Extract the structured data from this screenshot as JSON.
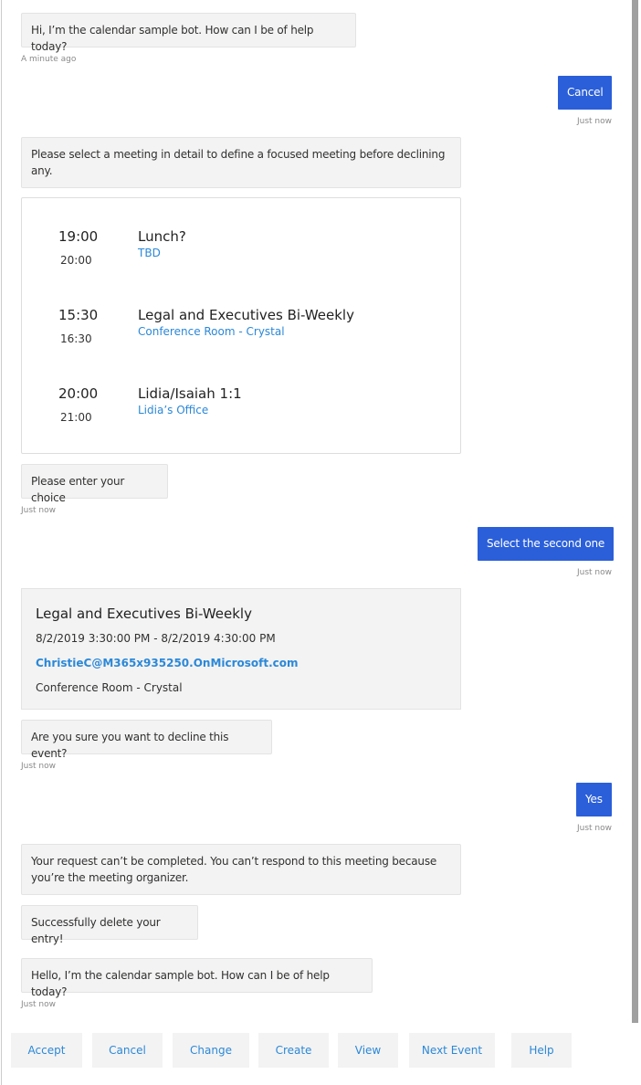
{
  "messages": {
    "m1": {
      "text": "Hi, I’m the calendar sample bot. How can I be of help today?",
      "time": "A minute ago"
    },
    "u1": {
      "text": "Cancel",
      "time": "Just now"
    },
    "m2": {
      "text": "Please select a meeting in detail to define a focused meeting before declining any."
    },
    "meetings": [
      {
        "start": "19:00",
        "end": "20:00",
        "title": "Lunch?",
        "location": "TBD"
      },
      {
        "start": "15:30",
        "end": "16:30",
        "title": "Legal and Executives Bi-Weekly",
        "location": "Conference Room - Crystal"
      },
      {
        "start": "20:00",
        "end": "21:00",
        "title": "Lidia/Isaiah 1:1",
        "location": "Lidia’s Office"
      }
    ],
    "m3": {
      "text": "Please enter your choice",
      "time": "Just now"
    },
    "u2": {
      "text": "Select the second one",
      "time": "Just now"
    },
    "detail": {
      "title": "Legal and Executives Bi-Weekly",
      "datetime": "8/2/2019 3:30:00 PM - 8/2/2019 4:30:00 PM",
      "organizer": "ChristieC@M365x935250.OnMicrosoft.com",
      "location": "Conference Room - Crystal"
    },
    "m4": {
      "text": "Are you sure you want to decline this event?",
      "time": "Just now"
    },
    "u3": {
      "text": "Yes",
      "time": "Just now"
    },
    "m5": {
      "text": "Your request can’t be completed. You can’t respond to this meeting because you’re the meeting organizer."
    },
    "m6": {
      "text": "Successfully delete your entry!"
    },
    "m7": {
      "text": "Hello, I’m the calendar sample bot. How can I be of help today?",
      "time": "Just now"
    }
  },
  "suggested_actions": [
    "Accept",
    "Cancel",
    "Change",
    "Create",
    "View",
    "Next Event",
    "Help"
  ],
  "colors": {
    "user_bubble": "#2b5fd9",
    "link": "#2b88d8",
    "bot_bubble": "#f3f3f3"
  }
}
